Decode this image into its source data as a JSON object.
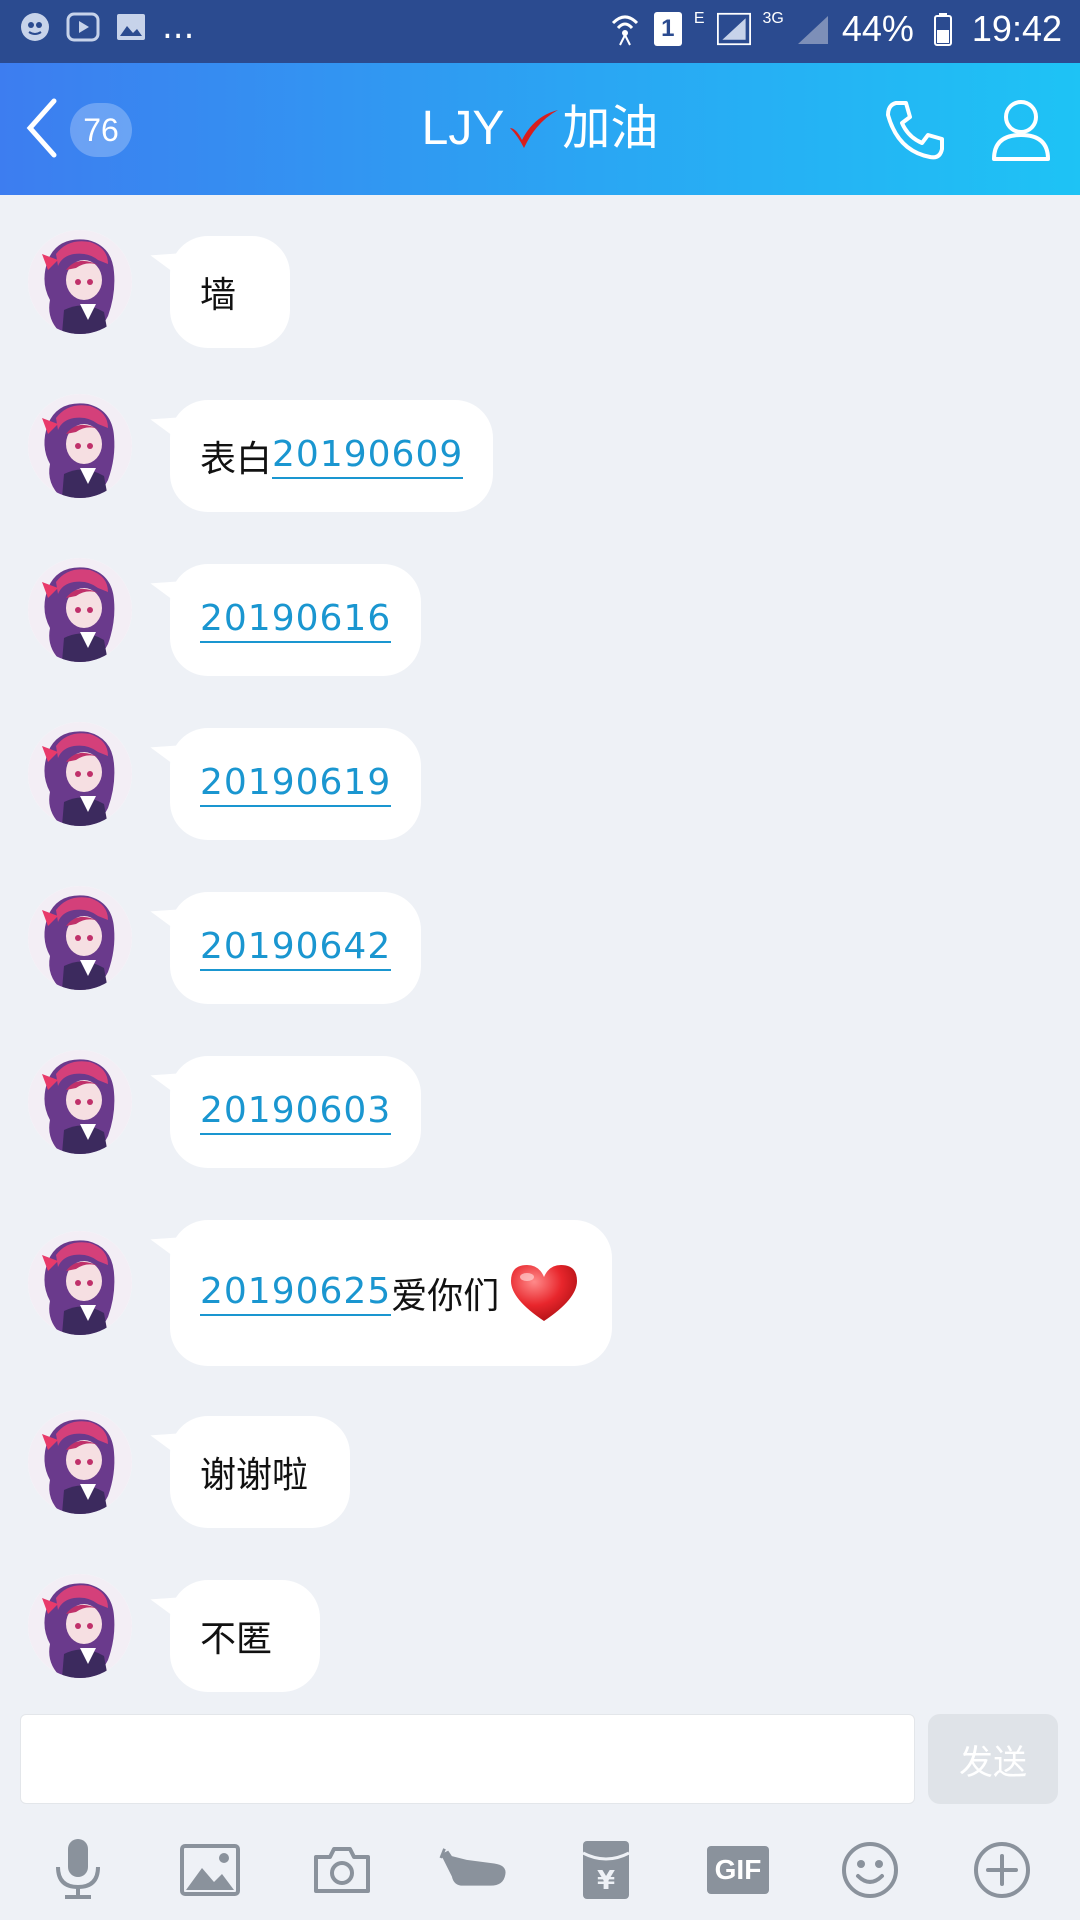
{
  "status_bar": {
    "notification_icons": [
      "baidu-icon",
      "video-icon",
      "image-icon"
    ],
    "more": "...",
    "sim_badge": "1",
    "network_e": "E",
    "network_3g": "3G",
    "battery": "44%",
    "time": "19:42"
  },
  "header": {
    "back_count": "76",
    "title_prefix": "LJY",
    "title_suffix": "加油",
    "colors": {
      "gradient_start": "#3d7df0",
      "gradient_end": "#1ec3f5"
    }
  },
  "messages": [
    {
      "parts": [
        {
          "type": "text",
          "value": "墙"
        }
      ]
    },
    {
      "parts": [
        {
          "type": "text",
          "value": "表白"
        },
        {
          "type": "link",
          "value": "20190609"
        }
      ]
    },
    {
      "parts": [
        {
          "type": "link",
          "value": "20190616"
        }
      ]
    },
    {
      "parts": [
        {
          "type": "link",
          "value": "20190619"
        }
      ]
    },
    {
      "parts": [
        {
          "type": "link",
          "value": "20190642"
        }
      ]
    },
    {
      "parts": [
        {
          "type": "link",
          "value": "20190603"
        }
      ]
    },
    {
      "parts": [
        {
          "type": "link",
          "value": "20190625"
        },
        {
          "type": "text",
          "value": "爱你们"
        },
        {
          "type": "icon",
          "value": "heart-icon"
        }
      ]
    },
    {
      "parts": [
        {
          "type": "text",
          "value": "谢谢啦"
        }
      ]
    },
    {
      "parts": [
        {
          "type": "text",
          "value": "不匿"
        }
      ]
    }
  ],
  "composer": {
    "input_value": "",
    "send_label": "发送"
  },
  "toolbar": {
    "items": [
      "mic-icon",
      "image-icon",
      "camera-icon",
      "poke-icon",
      "red-packet-icon",
      "gif-icon",
      "emoji-icon",
      "plus-icon"
    ],
    "gif_label": "GIF"
  }
}
